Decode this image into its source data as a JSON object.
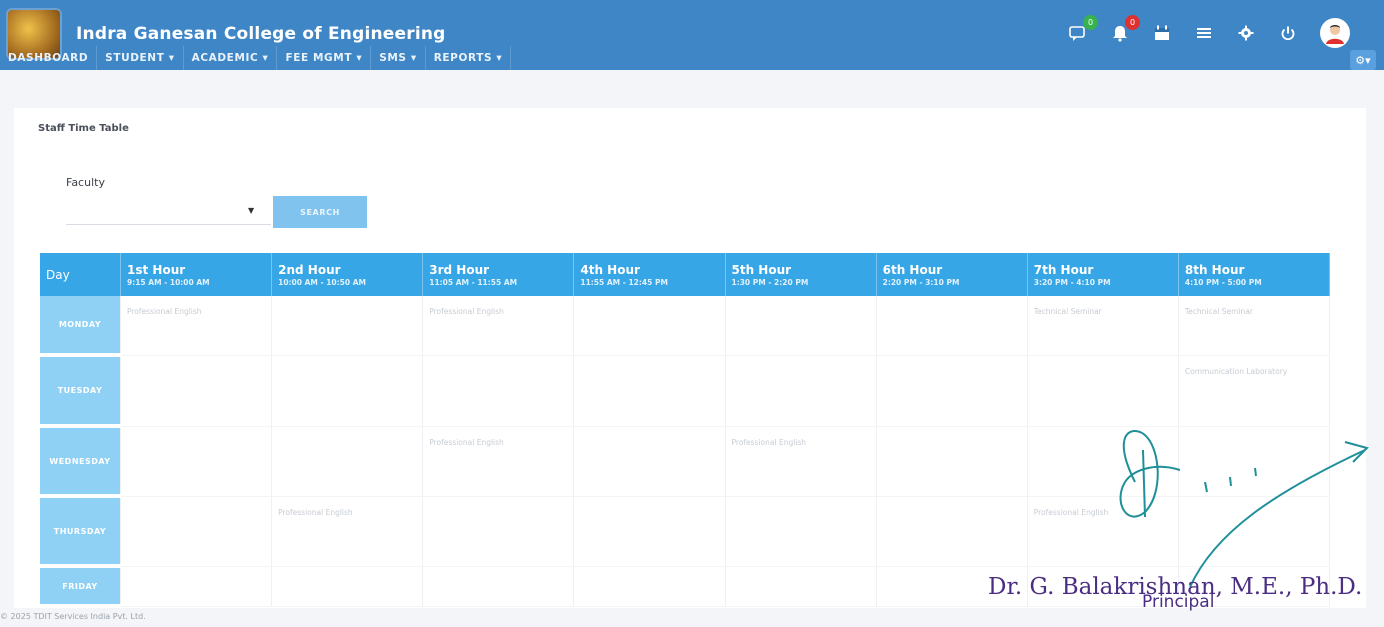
{
  "header": {
    "college_name": "Indra Ganesan College of Engineering",
    "alerts_text": ""
  },
  "header_badges": {
    "messages": "0",
    "notifications": "0"
  },
  "nav": {
    "items": [
      {
        "label": "DASHBOARD"
      },
      {
        "label": "STUDENT ▾"
      },
      {
        "label": "ACADEMIC ▾"
      },
      {
        "label": "FEE MGMT ▾"
      },
      {
        "label": "SMS ▾"
      },
      {
        "label": "REPORTS ▾"
      }
    ]
  },
  "page": {
    "title": "Staff Time Table",
    "faculty_label": "Faculty",
    "faculty_value": "",
    "search_label": "SEARCH"
  },
  "timetable": {
    "day_header": "Day",
    "hours": [
      {
        "name": "1st Hour",
        "time": "9:15 AM - 10:00 AM"
      },
      {
        "name": "2nd Hour",
        "time": "10:00 AM - 10:50 AM"
      },
      {
        "name": "3rd Hour",
        "time": "11:05 AM - 11:55 AM"
      },
      {
        "name": "4th Hour",
        "time": "11:55 AM - 12:45 PM"
      },
      {
        "name": "5th Hour",
        "time": "1:30 PM - 2:20 PM"
      },
      {
        "name": "6th Hour",
        "time": "2:20 PM - 3:10 PM"
      },
      {
        "name": "7th Hour",
        "time": "3:20 PM - 4:10 PM"
      },
      {
        "name": "8th Hour",
        "time": "4:10 PM - 5:00 PM"
      }
    ],
    "rows": [
      {
        "day": "MONDAY",
        "cells": [
          "Professional English",
          "",
          "Professional English",
          "",
          "",
          "",
          "Technical Seminar",
          "Technical Seminar"
        ]
      },
      {
        "day": "TUESDAY",
        "cells": [
          "",
          "",
          "",
          "",
          "",
          "",
          "",
          "Communication Laboratory"
        ]
      },
      {
        "day": "WEDNESDAY",
        "cells": [
          "",
          "",
          "Professional English",
          "",
          "Professional English",
          "",
          "",
          ""
        ]
      },
      {
        "day": "THURSDAY",
        "cells": [
          "",
          "Professional English",
          "",
          "",
          "",
          "",
          "Professional English",
          ""
        ]
      },
      {
        "day": "FRIDAY",
        "cells": [
          "",
          "",
          "",
          "",
          "",
          "",
          "",
          ""
        ]
      }
    ]
  },
  "footer": {
    "text": "© 2025 TDIT Services India Pvt. Ltd."
  },
  "signature": {
    "name": "Dr. G. Balakrishnan, M.E., Ph.D.",
    "title": "Principal"
  },
  "colors": {
    "topbar": "#3f86c6",
    "table_header": "#37a6e6",
    "day_cell": "#8fd1f5"
  }
}
